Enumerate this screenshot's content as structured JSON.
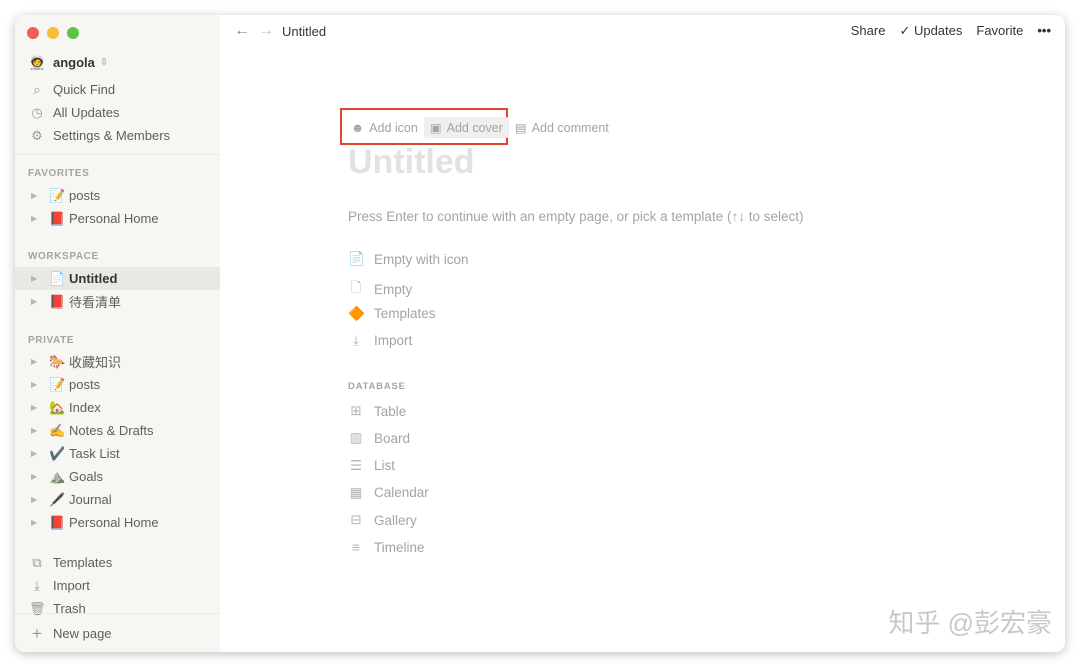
{
  "sidebar": {
    "workspace": "angola",
    "quick_find": "Quick Find",
    "all_updates": "All Updates",
    "settings": "Settings & Members",
    "favorites_label": "FAVORITES",
    "favorites": [
      {
        "emoji": "📝",
        "label": "posts"
      },
      {
        "emoji": "📕",
        "label": "Personal Home"
      }
    ],
    "workspace_label": "WORKSPACE",
    "workspace_pages": [
      {
        "emoji": "📄",
        "label": "Untitled"
      },
      {
        "emoji": "📕",
        "label": "待看清单"
      }
    ],
    "private_label": "PRIVATE",
    "private_pages": [
      {
        "emoji": "🐎",
        "label": "收藏知识"
      },
      {
        "emoji": "📝",
        "label": "posts"
      },
      {
        "emoji": "🏡",
        "label": "Index"
      },
      {
        "emoji": "✍️",
        "label": "Notes & Drafts"
      },
      {
        "emoji": "✔️",
        "label": "Task List"
      },
      {
        "emoji": "⛰️",
        "label": "Goals"
      },
      {
        "emoji": "🖋️",
        "label": "Journal"
      },
      {
        "emoji": "📕",
        "label": "Personal Home"
      }
    ],
    "templates": "Templates",
    "import": "Import",
    "trash": "Trash",
    "new_page": "New page"
  },
  "topbar": {
    "breadcrumb": "Untitled",
    "share": "Share",
    "updates": "Updates",
    "favorite": "Favorite",
    "more": "•••"
  },
  "page": {
    "add_icon": "Add icon",
    "add_cover": "Add cover",
    "add_comment": "Add comment",
    "title_placeholder": "Untitled",
    "hint": "Press Enter to continue with an empty page, or pick a template (↑↓ to select)",
    "options": [
      "Empty with icon",
      "Empty",
      "Templates",
      "Import"
    ],
    "database_label": "DATABASE",
    "database_options": [
      "Table",
      "Board",
      "List",
      "Calendar",
      "Gallery",
      "Timeline"
    ]
  },
  "highlight_color": "#e0442f",
  "watermark": "知乎 @彭宏豪"
}
